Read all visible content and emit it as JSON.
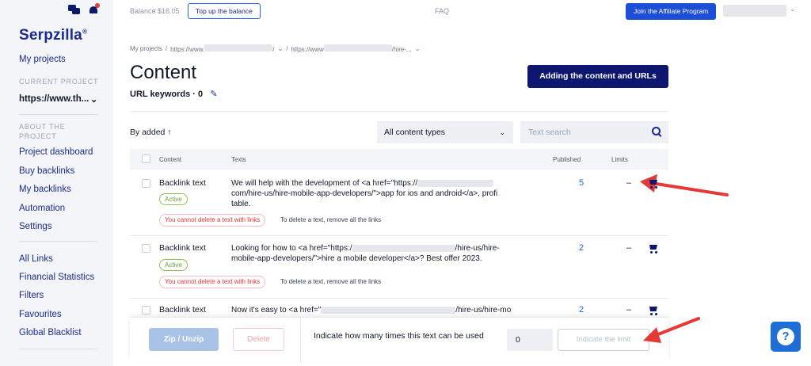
{
  "sidebar": {
    "logo": "Serpzilla",
    "logo_mark": "®",
    "my_projects": "My projects",
    "current_project_heading": "CURRENT PROJECT",
    "current_project": "https://www.th...",
    "about_heading": "ABOUT THE PROJECT",
    "project_items": [
      "Project dashboard",
      "Buy backlinks",
      "My backlinks",
      "Automation",
      "Settings"
    ],
    "global_items": [
      "All Links",
      "Financial Statistics",
      "Filters",
      "Favourites",
      "Global Blacklist"
    ]
  },
  "topbar": {
    "balance": "Balance $16.05",
    "topup": "Top up the balance",
    "faq": "FAQ",
    "affiliate": "Join the Affiliate Program"
  },
  "breadcrumb": {
    "root": "My projects",
    "sep": "/",
    "site_prefix": "https://www.",
    "page_prefix": "https://www",
    "page_suffix": "/hire-..."
  },
  "page": {
    "title": "Content",
    "keywords": "URL keywords · 0",
    "add_button": "Adding the content and URLs"
  },
  "filters": {
    "sort": "By added ↑",
    "content_type": "All content types",
    "search_placeholder": "Text search"
  },
  "table": {
    "headers": {
      "content": "Content",
      "texts": "Texts",
      "published": "Published",
      "limits": "Limits"
    },
    "rows": [
      {
        "type": "Backlink text",
        "status": "Active",
        "text_a": "We will help with the development of <a href=\"https://",
        "text_b": "com/hire-us/hire-mobile-app-developers/\">app for ios and android</a>, profi",
        "text_c": "table.",
        "warning": "You cannot delete a text with links",
        "hint": "To delete a text, remove all the links",
        "published": "5",
        "limits": "–"
      },
      {
        "type": "Backlink text",
        "status": "Active",
        "text_a": "Looking for how to <a href=\"https:/",
        "text_a2": "/hire-us/hire-",
        "text_b": "mobile-app-developers/\">hire a mobile developer</a>? Best offer 2023.",
        "warning": "You cannot delete a text with links",
        "hint": "To delete a text, remove all the links",
        "published": "2",
        "limits": "–"
      },
      {
        "type": "Backlink text",
        "text_a": "Now it's easy to <a href=\"",
        "text_a2": "/hire-us/hire-mo",
        "published": "2",
        "limits": "–"
      }
    ]
  },
  "bottombar": {
    "zip": "Zip / Unzip",
    "delete": "Delete",
    "limit_text": "Indicate how many times this text can be used",
    "limit_value": "0",
    "limit_button": "Indicate the limit"
  },
  "help_label": "?",
  "colors": {
    "brand": "#1a2b8c",
    "primary_button": "#0d1770",
    "accent_blue": "#1d4ed8",
    "annotation_red": "#e53935"
  }
}
